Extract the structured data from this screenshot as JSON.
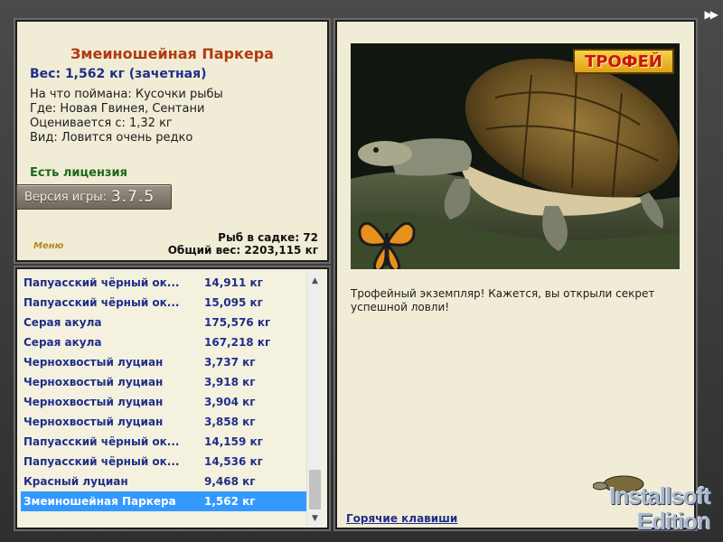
{
  "fish": {
    "name": "Змеиношейная Паркера",
    "weight_line": "Вес: 1,562 кг (зачетная)",
    "bait_line": "На что поймана: Кусочки рыбы",
    "location_line": "Где: Новая Гвинея, Сентани",
    "value_line": "Оценивается с: 1,32 кг",
    "rarity_line": "Вид: Ловится очень редко"
  },
  "license_text": "Есть лицензия",
  "version": {
    "label": "Версия игры:",
    "value": "3.7.5"
  },
  "menu_label": "Меню",
  "totals": {
    "fish_count_line": "Рыб в садке: 72",
    "total_weight_line": "Общий вес: 2203,115 кг"
  },
  "catch_list": [
    {
      "name": "Папуасский чёрный ок...",
      "weight": "14,911 кг"
    },
    {
      "name": "Папуасский чёрный ок...",
      "weight": "15,095 кг"
    },
    {
      "name": "Серая акула",
      "weight": "175,576 кг"
    },
    {
      "name": "Серая акула",
      "weight": "167,218 кг"
    },
    {
      "name": "Чернохвостый луциан",
      "weight": "3,737 кг"
    },
    {
      "name": "Чернохвостый луциан",
      "weight": "3,918 кг"
    },
    {
      "name": "Чернохвостый луциан",
      "weight": "3,904 кг"
    },
    {
      "name": "Чернохвостый луциан",
      "weight": "3,858 кг"
    },
    {
      "name": "Папуасский чёрный ок...",
      "weight": "14,159 кг"
    },
    {
      "name": "Папуасский чёрный ок...",
      "weight": "14,536 кг"
    },
    {
      "name": "Красный луциан",
      "weight": "9,468 кг"
    },
    {
      "name": "Змеиношейная Паркера",
      "weight": "1,562 кг",
      "selected": true
    }
  ],
  "trophy_badge": "ТРОФЕЙ",
  "trophy_message": "Трофейный экземпляр! Кажется, вы открыли секрет успешной ловли!",
  "hotkeys_link": "Горячие клавиши",
  "logo": {
    "line1": "Installsoft",
    "line2": "Edition"
  },
  "icons": {
    "next": "fast-forward-icon",
    "scroll_up": "chevron-up-icon",
    "scroll_down": "chevron-down-icon"
  },
  "colors": {
    "title": "#b23a10",
    "weight": "#1f2e8a",
    "license": "#1b6a1b",
    "selection": "#3399ff",
    "panel": "#f1ecd6"
  }
}
